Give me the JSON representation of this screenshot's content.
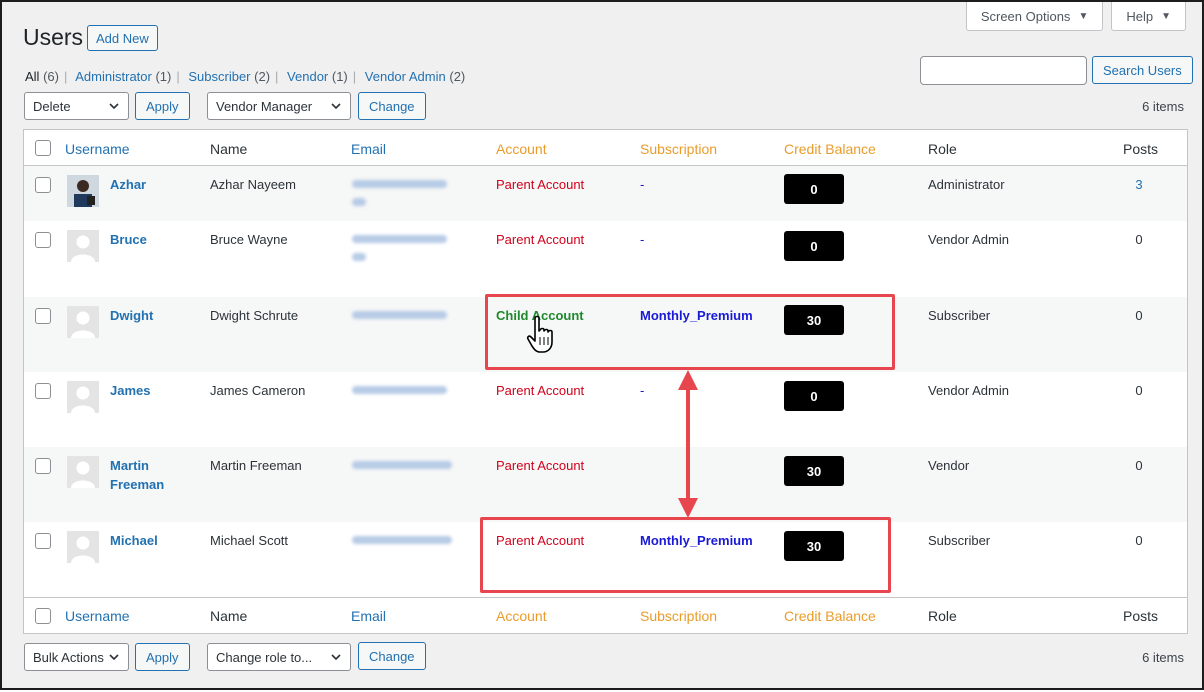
{
  "header": {
    "title": "Users",
    "add_new": "Add New",
    "screen_options": "Screen Options",
    "help": "Help"
  },
  "views": [
    {
      "label": "All",
      "count": "(6)"
    },
    {
      "label": "Administrator",
      "count": "(1)"
    },
    {
      "label": "Subscriber",
      "count": "(2)"
    },
    {
      "label": "Vendor",
      "count": "(1)"
    },
    {
      "label": "Vendor Admin",
      "count": "(2)"
    }
  ],
  "search": {
    "placeholder": "",
    "button": "Search Users"
  },
  "top_actions": {
    "bulk_selected": "Delete",
    "apply": "Apply",
    "role_selected": "Vendor Manager",
    "change": "Change",
    "items": "6 items"
  },
  "bottom_actions": {
    "bulk_selected": "Bulk Actions",
    "apply": "Apply",
    "role_selected": "Change role to...",
    "change": "Change",
    "items": "6 items"
  },
  "columns": {
    "username": "Username",
    "name": "Name",
    "email": "Email",
    "account": "Account",
    "subscription": "Subscription",
    "credit_balance": "Credit Balance",
    "role": "Role",
    "posts": "Posts"
  },
  "rows": [
    {
      "username": "Azhar",
      "name": "Azhar Nayeem",
      "account": "Parent Account",
      "account_type": "parent",
      "subscription": "-",
      "credit": "0",
      "role": "Administrator",
      "posts": "3"
    },
    {
      "username": "Bruce",
      "name": "Bruce Wayne",
      "account": "Parent Account",
      "account_type": "parent",
      "subscription": "-",
      "credit": "0",
      "role": "Vendor Admin",
      "posts": "0"
    },
    {
      "username": "Dwight",
      "name": "Dwight Schrute",
      "account": "Child Account",
      "account_type": "child",
      "subscription": "Monthly_Premium",
      "credit": "30",
      "role": "Subscriber",
      "posts": "0"
    },
    {
      "username": "James",
      "name": "James Cameron",
      "account": "Parent Account",
      "account_type": "parent",
      "subscription": "-",
      "credit": "0",
      "role": "Vendor Admin",
      "posts": "0"
    },
    {
      "username_line1": "Martin",
      "username_line2": "Freeman",
      "name": "Martin Freeman",
      "account": "Parent Account",
      "account_type": "parent",
      "subscription": "",
      "credit": "30",
      "role": "Vendor",
      "posts": "0"
    },
    {
      "username": "Michael",
      "name": "Michael Scott",
      "account": "Parent Account",
      "account_type": "parent",
      "subscription": "Monthly_Premium",
      "credit": "30",
      "role": "Subscriber",
      "posts": "0"
    }
  ],
  "colors": {
    "link": "#2271b1",
    "header_accent": "#e99c2a",
    "parent_account": "#d0021b",
    "child_account": "#1e8a2c",
    "subscription": "#1a1ad6",
    "highlight": "#e8464e",
    "badge_bg": "#000000"
  }
}
